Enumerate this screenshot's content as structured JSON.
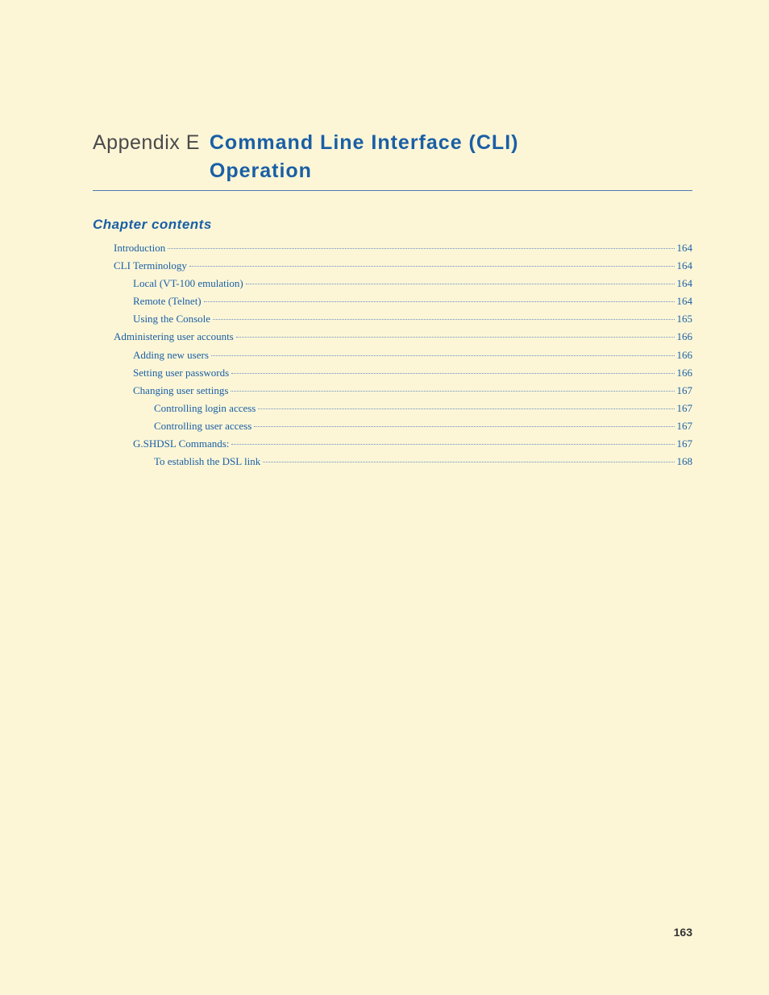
{
  "header": {
    "appendix_label": "Appendix E",
    "appendix_title_line1": "Command Line Interface (CLI)",
    "appendix_title_line2": "Operation"
  },
  "section_heading": "Chapter contents",
  "toc": [
    {
      "title": "Introduction",
      "page": "164",
      "indent": 0
    },
    {
      "title": "CLI Terminology",
      "page": "164",
      "indent": 0
    },
    {
      "title": "Local (VT-100 emulation)",
      "page": "164",
      "indent": 1
    },
    {
      "title": "Remote (Telnet)",
      "page": "164",
      "indent": 1
    },
    {
      "title": "Using the Console",
      "page": "165",
      "indent": 1
    },
    {
      "title": "Administering user accounts",
      "page": "166",
      "indent": 0
    },
    {
      "title": "Adding new users",
      "page": "166",
      "indent": 1
    },
    {
      "title": "Setting user passwords",
      "page": "166",
      "indent": 1
    },
    {
      "title": "Changing user settings",
      "page": "167",
      "indent": 1
    },
    {
      "title": "Controlling login access",
      "page": "167",
      "indent": 2
    },
    {
      "title": "Controlling user access",
      "page": "167",
      "indent": 2
    },
    {
      "title": "G.SHDSL Commands:",
      "page": "167",
      "indent": 1
    },
    {
      "title": "To establish the DSL link",
      "page": "168",
      "indent": 2
    }
  ],
  "page_number": "163"
}
